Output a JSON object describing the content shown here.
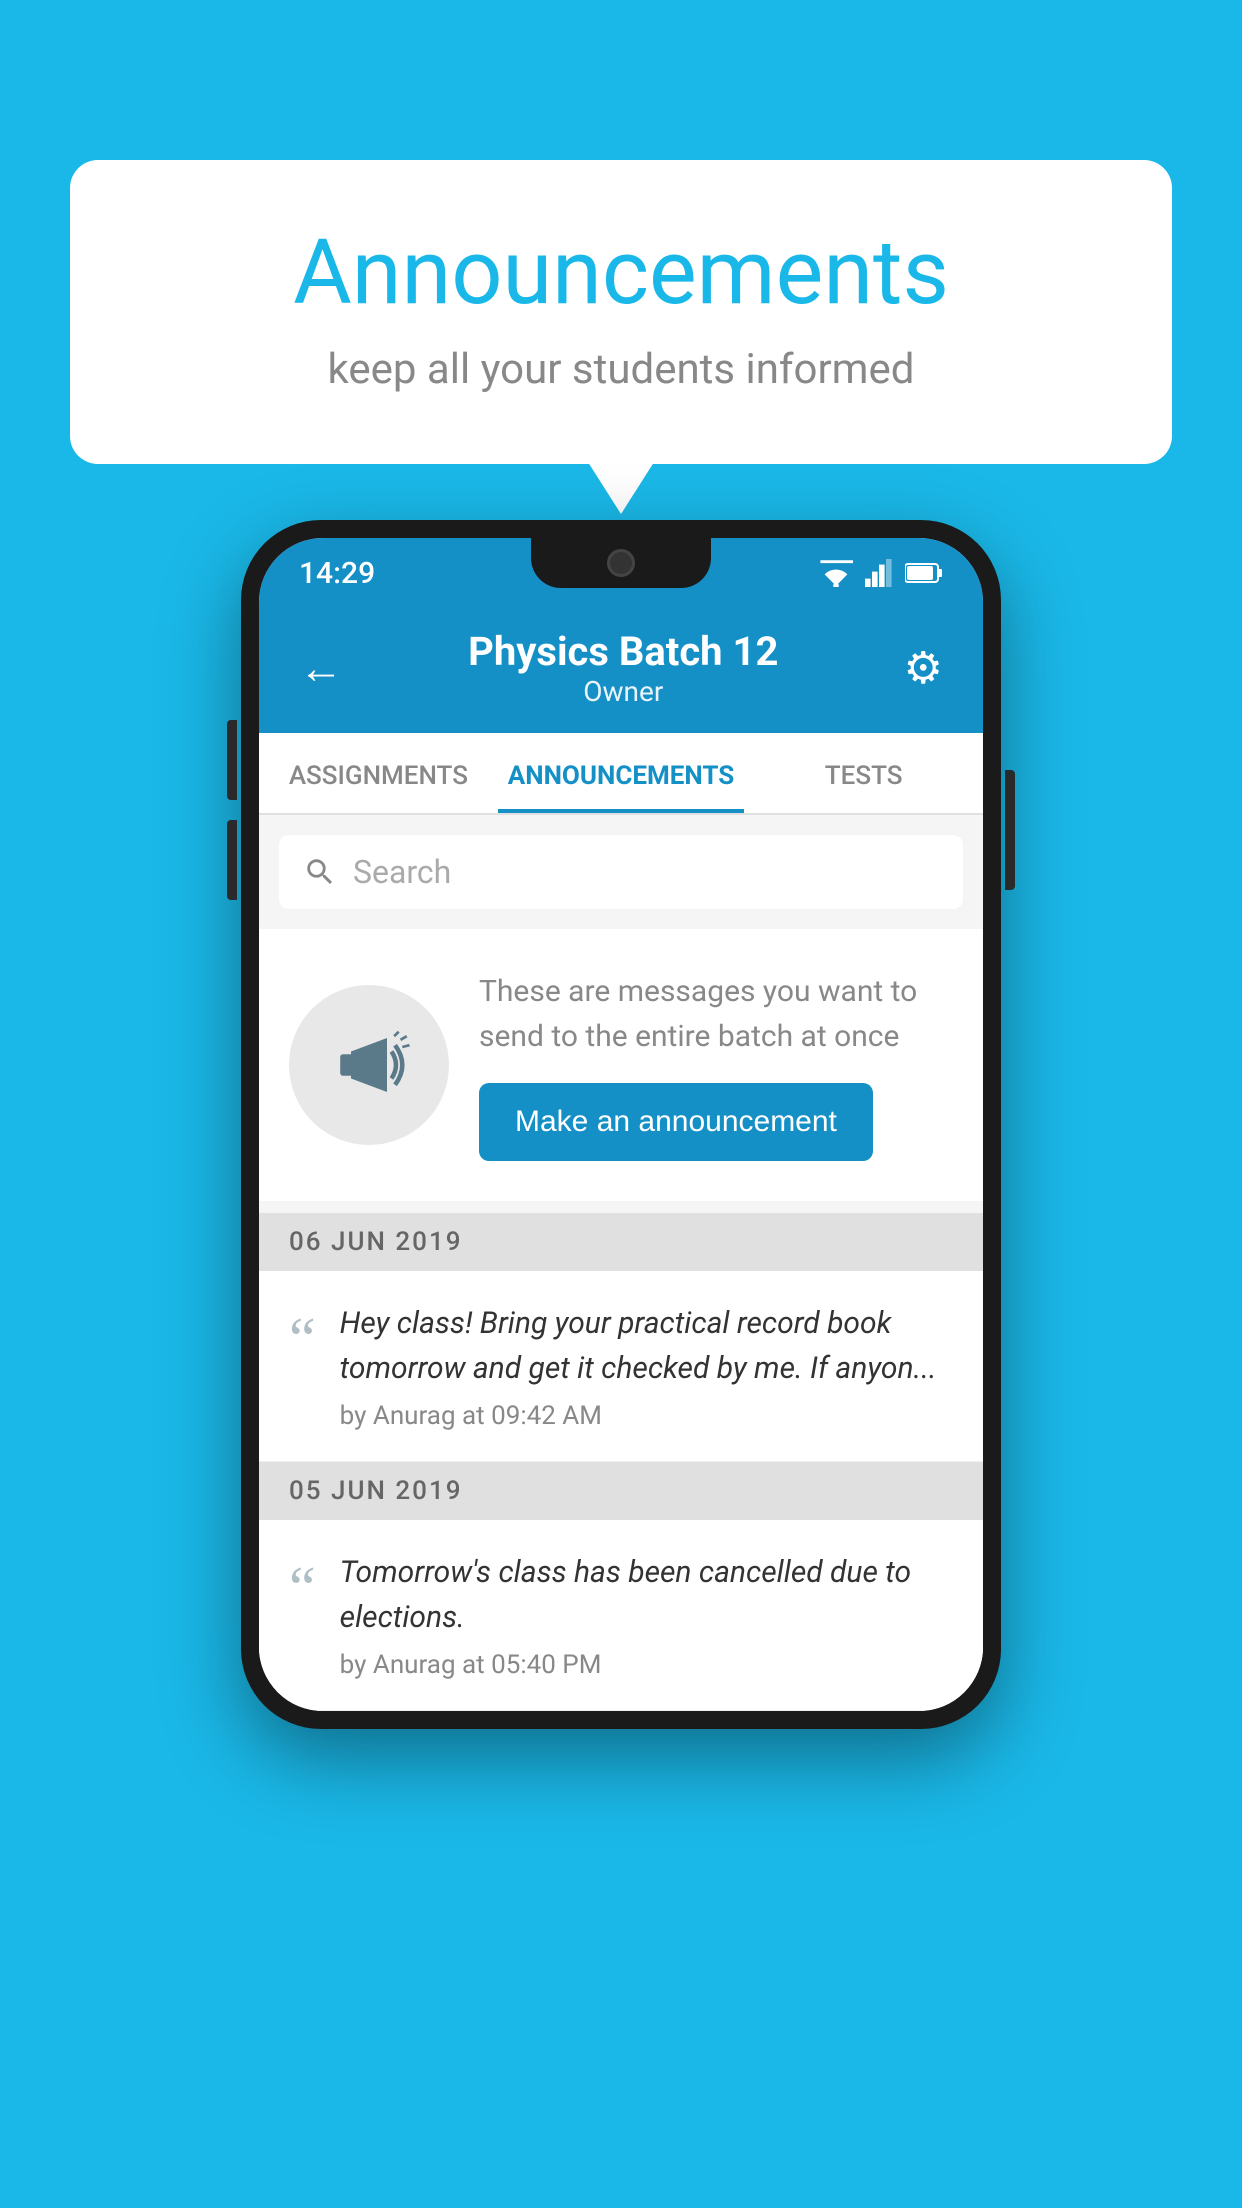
{
  "bubble": {
    "title": "Announcements",
    "subtitle": "keep all your students informed"
  },
  "phone": {
    "status_bar": {
      "time": "14:29"
    },
    "app_bar": {
      "title": "Physics Batch 12",
      "subtitle": "Owner"
    },
    "tabs": [
      {
        "label": "ASSIGNMENTS",
        "active": false
      },
      {
        "label": "ANNOUNCEMENTS",
        "active": true
      },
      {
        "label": "TESTS",
        "active": false
      },
      {
        "label": "",
        "active": false
      }
    ],
    "search": {
      "placeholder": "Search"
    },
    "intro": {
      "description": "These are messages you want to send to the entire batch at once",
      "button_label": "Make an announcement"
    },
    "announcements": [
      {
        "date": "06  JUN  2019",
        "text": "Hey class! Bring your practical record book tomorrow and get it checked by me. If anyon...",
        "meta": "by Anurag at 09:42 AM"
      },
      {
        "date": "05  JUN  2019",
        "text": "Tomorrow's class has been cancelled due to elections.",
        "meta": "by Anurag at 05:40 PM"
      }
    ]
  },
  "colors": {
    "primary": "#1590c7",
    "background": "#1ab8e8",
    "white": "#ffffff"
  }
}
